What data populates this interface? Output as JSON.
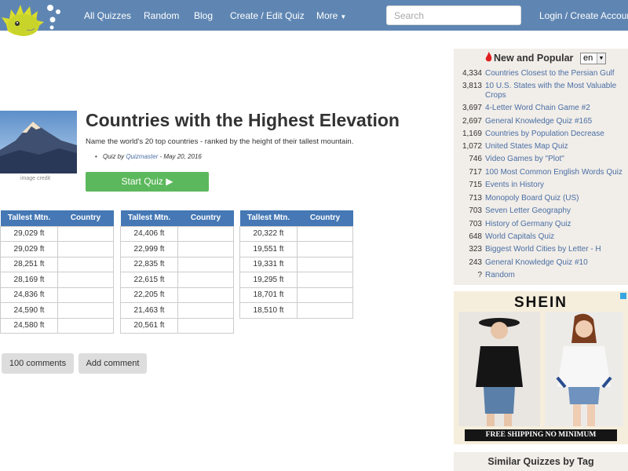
{
  "nav": {
    "links": [
      "All Quizzes",
      "Random",
      "Blog",
      "Create / Edit Quiz",
      "More"
    ],
    "search_placeholder": "Search",
    "login": "Login / Create Account"
  },
  "quiz": {
    "title": "Countries with the Highest Elevation",
    "description": "Name the world's 20 top countries - ranked by the height of their tallest mountain.",
    "byline_prefix": "Quiz by",
    "author": "Quizmaster",
    "date": "- May 20, 2016",
    "image_credit": "image credit",
    "start_label": "Start Quiz ▶"
  },
  "tables": {
    "headers": [
      "Tallest Mtn.",
      "Country"
    ],
    "col1": [
      "29,029 ft",
      "29,029 ft",
      "28,251 ft",
      "28,169 ft",
      "24,836 ft",
      "24,590 ft",
      "24,580 ft"
    ],
    "col2": [
      "24,406 ft",
      "22,999 ft",
      "22,835 ft",
      "22,615 ft",
      "22,205 ft",
      "21,463 ft",
      "20,561 ft"
    ],
    "col3": [
      "20,322 ft",
      "19,551 ft",
      "19,331 ft",
      "19,295 ft",
      "18,701 ft",
      "18,510 ft"
    ]
  },
  "comments": {
    "count_label": "100 comments",
    "add_label": "Add comment"
  },
  "sidebar": {
    "title": "New and Popular",
    "lang": "en",
    "items": [
      {
        "num": "4,334",
        "label": "Countries Closest to the Persian Gulf"
      },
      {
        "num": "3,813",
        "label": "10 U.S. States with the Most Valuable",
        "label2": "Crops"
      },
      {
        "num": "3,697",
        "label": "4-Letter Word Chain Game #2"
      },
      {
        "num": "2,697",
        "label": "General Knowledge Quiz #165"
      },
      {
        "num": "1,169",
        "label": "Countries by Population Decrease"
      },
      {
        "num": "1,072",
        "label": "United States Map Quiz"
      },
      {
        "num": "746",
        "label": "Video Games by \"Plot\""
      },
      {
        "num": "717",
        "label": "100 Most Common English Words Quiz"
      },
      {
        "num": "715",
        "label": "Events in History"
      },
      {
        "num": "713",
        "label": "Monopoly Board Quiz (US)"
      },
      {
        "num": "703",
        "label": "Seven Letter Geography"
      },
      {
        "num": "703",
        "label": "History of Germany Quiz"
      },
      {
        "num": "648",
        "label": "World Capitals Quiz"
      },
      {
        "num": "323",
        "label": "Biggest World Cities by Letter - H"
      },
      {
        "num": "243",
        "label": "General Knowledge Quiz #10"
      },
      {
        "num": "?",
        "label": "Random"
      }
    ],
    "similar_title": "Similar Quizzes by Tag"
  },
  "ad": {
    "brand": "SHEIN",
    "banner": "FREE SHIPPING NO MINIMUM"
  },
  "colors": {
    "nav": "#5f86b3",
    "table_header": "#4578b4",
    "start_button": "#5cb85c",
    "link": "#4a6fa5",
    "sidebar_bg": "#f1ede8"
  }
}
